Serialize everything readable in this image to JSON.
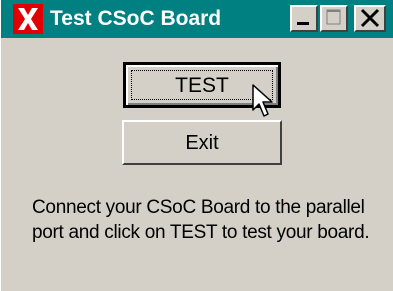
{
  "window": {
    "title": "Test CSoC Board",
    "title_bar_color": "#008080",
    "app_icon": "x-icon"
  },
  "caption_buttons": {
    "minimize_icon": "minimize-icon",
    "maximize_icon": "maximize-icon",
    "close_icon": "close-icon"
  },
  "buttons": {
    "test_label": "TEST",
    "exit_label": "Exit"
  },
  "message": "Connect your CSoC Board to the parallel port and click on TEST to test your board."
}
